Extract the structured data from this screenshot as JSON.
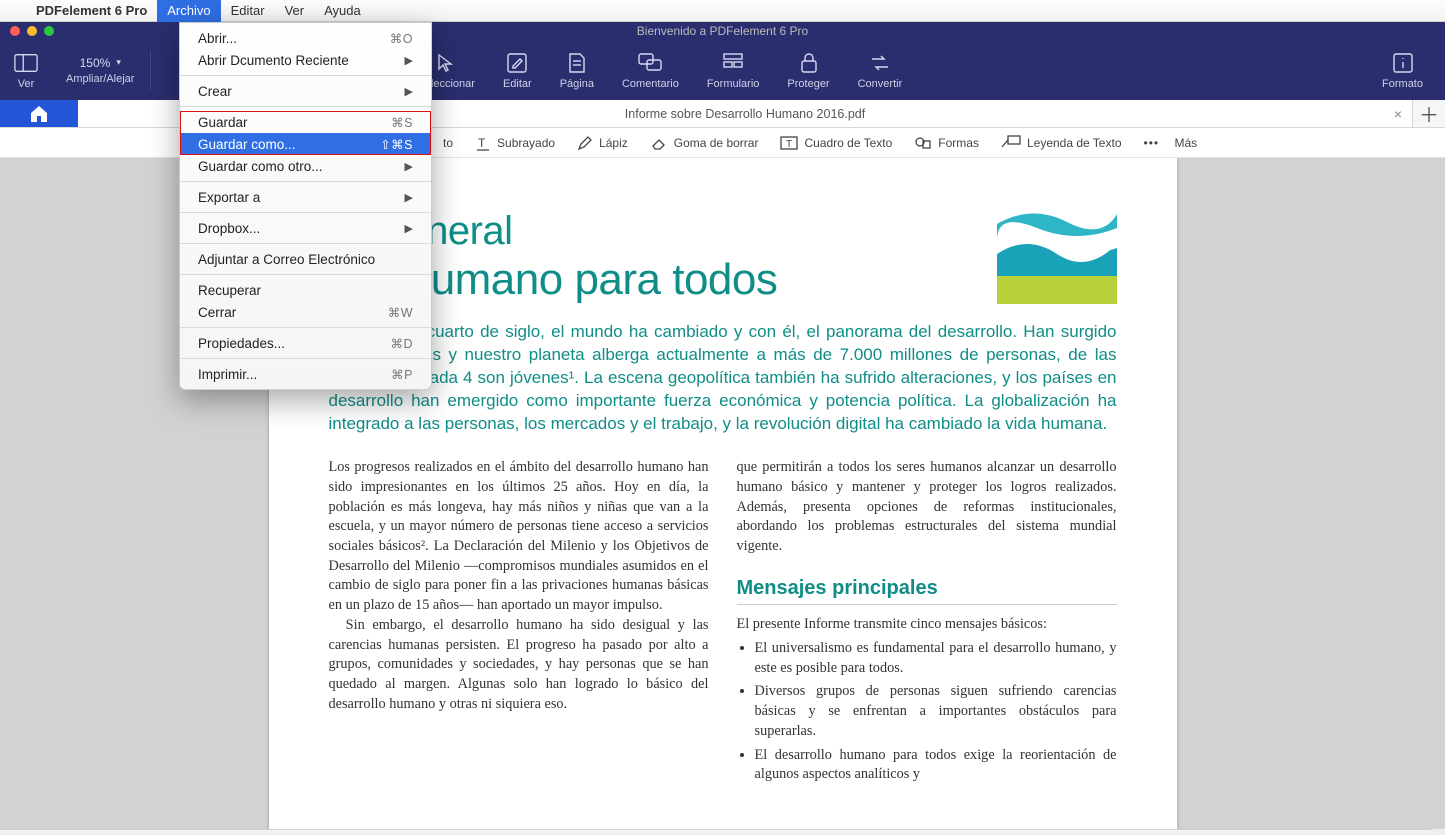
{
  "menubar": {
    "app_name": "PDFelement 6 Pro",
    "items": [
      "Archivo",
      "Editar",
      "Ver",
      "Ayuda"
    ],
    "active_index": 0
  },
  "window": {
    "title": "Bienvenido a PDFelement 6 Pro"
  },
  "toolbar": {
    "ver": "Ver",
    "zoom": "150%",
    "ampliar": "Ampliar/Alejar",
    "seleccionar": "Seleccionar",
    "editar": "Editar",
    "pagina": "Página",
    "comentario": "Comentario",
    "formulario": "Formulario",
    "proteger": "Proteger",
    "convertir": "Convertir",
    "formato": "Formato"
  },
  "tabs": {
    "document": "Informe sobre Desarrollo Humano 2016.pdf",
    "close": "×",
    "plus": "＋"
  },
  "editstrip": {
    "partial": "to",
    "subrayado": "Subrayado",
    "lapiz": "Lápiz",
    "goma": "Goma de borrar",
    "cuadro": "Cuadro de Texto",
    "formas": "Formas",
    "leyenda": "Leyenda de Texto",
    "mas": "Más"
  },
  "dropdown": {
    "abrir": "Abrir...",
    "abrir_sc": "⌘O",
    "reciente": "Abrir Dcumento Reciente",
    "crear": "Crear",
    "guardar": "Guardar",
    "guardar_sc": "⌘S",
    "guardar_como": "Guardar como...",
    "guardar_como_sc": "⇧⌘S",
    "guardar_otro": "Guardar como otro...",
    "exportar": "Exportar a",
    "dropbox": "Dropbox...",
    "adjuntar": "Adjuntar a Correo Electrónico",
    "recuperar": "Recuperar",
    "cerrar": "Cerrar",
    "cerrar_sc": "⌘W",
    "propiedades": "Propiedades...",
    "propiedades_sc": "⌘D",
    "imprimir": "Imprimir...",
    "imprimir_sc": "⌘P"
  },
  "doc": {
    "h1a": "na general",
    "h1b": "ollo humano para todos",
    "intro": "En el último cuarto de siglo, el mundo ha cambiado y con él, el panorama del desarrollo. Han surgido nuevos países y nuestro planeta alberga actualmente a más de 7.000 millones de personas, de las cuales 1 de cada 4 son jóvenes¹. La escena geopolítica también ha sufrido alteraciones, y los países en desarrollo han emergido como importante fuerza económica y potencia política. La globalización ha integrado a las personas, los mercados y el trabajo, y la revolución digital ha cambiado la vida humana.",
    "col1a": "Los progresos realizados en el ámbito del desarrollo humano han sido impresionantes en los últimos 25 años. Hoy en día, la población es más longeva, hay más niños y niñas que van a la escuela, y un mayor número de personas tiene acceso a servicios sociales básicos². La Declaración del Milenio y los Objetivos de Desarrollo del Milenio —compromisos mundiales asumidos en el cambio de siglo para poner fin a las privaciones humanas básicas en un plazo de 15 años— han aportado un mayor impulso.",
    "col1b": "Sin embargo, el desarrollo humano ha sido desigual y las carencias humanas persisten. El progreso ha pasado por alto a grupos, comunidades y sociedades, y hay personas que se han quedado al margen. Algunas solo han logrado lo básico del desarrollo humano y otras ni siquiera eso.",
    "col2a": "que permitirán a todos los seres humanos alcanzar un desarrollo humano básico y mantener y proteger los logros realizados. Además, presenta opciones de reformas institucionales, abordando los problemas estructurales del sistema mundial vigente.",
    "col2h": "Mensajes principales",
    "col2b": "El presente Informe transmite cinco mensajes básicos:",
    "bul1": "El universalismo es fundamental para el desarrollo humano, y este es posible para todos.",
    "bul2": "Diversos grupos de personas siguen sufriendo carencias básicas y se enfrentan a importantes obstáculos para superarlas.",
    "bul3": "El desarrollo humano para todos exige la reorientación de algunos aspectos analíticos y"
  }
}
